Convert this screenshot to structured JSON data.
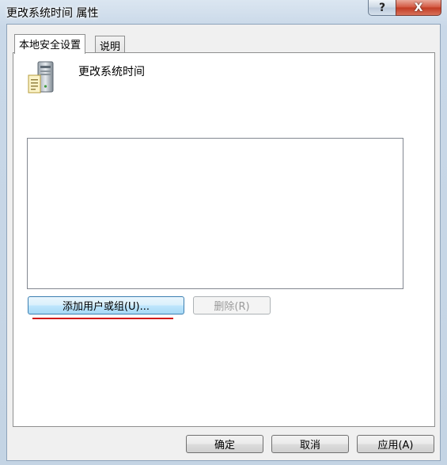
{
  "window": {
    "title": "更改系统时间 属性",
    "help_glyph": "?",
    "close_glyph": "X"
  },
  "tabs": [
    {
      "label": "本地安全设置",
      "active": true
    },
    {
      "label": "说明",
      "active": false
    }
  ],
  "policy": {
    "name": "更改系统时间",
    "icon": "server-policy-icon"
  },
  "members_list": [],
  "buttons": {
    "add": "添加用户或组(U)...",
    "remove": "删除(R)",
    "ok": "确定",
    "cancel": "取消",
    "apply": "应用(A)"
  },
  "colors": {
    "title_gradient_top": "#dbe6f1",
    "close_button": "#c13a22",
    "highlight_underline": "#d01a1a",
    "focus_border": "#3c7fb1"
  }
}
